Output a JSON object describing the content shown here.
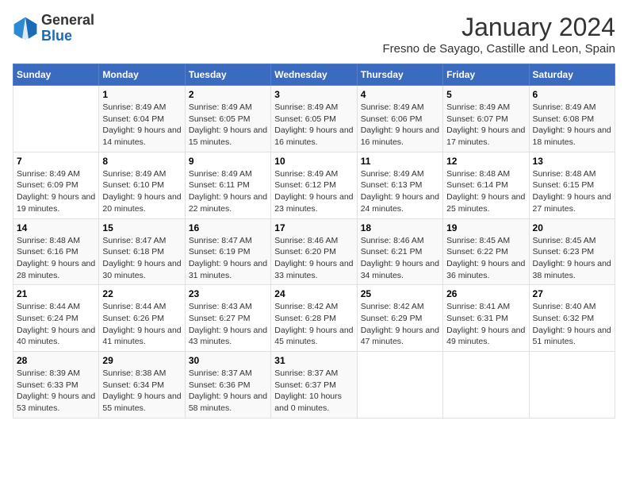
{
  "logo": {
    "general": "General",
    "blue": "Blue"
  },
  "title": "January 2024",
  "subtitle": "Fresno de Sayago, Castille and Leon, Spain",
  "weekdays": [
    "Sunday",
    "Monday",
    "Tuesday",
    "Wednesday",
    "Thursday",
    "Friday",
    "Saturday"
  ],
  "weeks": [
    [
      {
        "day": "",
        "sunrise": "",
        "sunset": "",
        "daylight": ""
      },
      {
        "day": "1",
        "sunrise": "Sunrise: 8:49 AM",
        "sunset": "Sunset: 6:04 PM",
        "daylight": "Daylight: 9 hours and 14 minutes."
      },
      {
        "day": "2",
        "sunrise": "Sunrise: 8:49 AM",
        "sunset": "Sunset: 6:05 PM",
        "daylight": "Daylight: 9 hours and 15 minutes."
      },
      {
        "day": "3",
        "sunrise": "Sunrise: 8:49 AM",
        "sunset": "Sunset: 6:05 PM",
        "daylight": "Daylight: 9 hours and 16 minutes."
      },
      {
        "day": "4",
        "sunrise": "Sunrise: 8:49 AM",
        "sunset": "Sunset: 6:06 PM",
        "daylight": "Daylight: 9 hours and 16 minutes."
      },
      {
        "day": "5",
        "sunrise": "Sunrise: 8:49 AM",
        "sunset": "Sunset: 6:07 PM",
        "daylight": "Daylight: 9 hours and 17 minutes."
      },
      {
        "day": "6",
        "sunrise": "Sunrise: 8:49 AM",
        "sunset": "Sunset: 6:08 PM",
        "daylight": "Daylight: 9 hours and 18 minutes."
      }
    ],
    [
      {
        "day": "7",
        "sunrise": "Sunrise: 8:49 AM",
        "sunset": "Sunset: 6:09 PM",
        "daylight": "Daylight: 9 hours and 19 minutes."
      },
      {
        "day": "8",
        "sunrise": "Sunrise: 8:49 AM",
        "sunset": "Sunset: 6:10 PM",
        "daylight": "Daylight: 9 hours and 20 minutes."
      },
      {
        "day": "9",
        "sunrise": "Sunrise: 8:49 AM",
        "sunset": "Sunset: 6:11 PM",
        "daylight": "Daylight: 9 hours and 22 minutes."
      },
      {
        "day": "10",
        "sunrise": "Sunrise: 8:49 AM",
        "sunset": "Sunset: 6:12 PM",
        "daylight": "Daylight: 9 hours and 23 minutes."
      },
      {
        "day": "11",
        "sunrise": "Sunrise: 8:49 AM",
        "sunset": "Sunset: 6:13 PM",
        "daylight": "Daylight: 9 hours and 24 minutes."
      },
      {
        "day": "12",
        "sunrise": "Sunrise: 8:48 AM",
        "sunset": "Sunset: 6:14 PM",
        "daylight": "Daylight: 9 hours and 25 minutes."
      },
      {
        "day": "13",
        "sunrise": "Sunrise: 8:48 AM",
        "sunset": "Sunset: 6:15 PM",
        "daylight": "Daylight: 9 hours and 27 minutes."
      }
    ],
    [
      {
        "day": "14",
        "sunrise": "Sunrise: 8:48 AM",
        "sunset": "Sunset: 6:16 PM",
        "daylight": "Daylight: 9 hours and 28 minutes."
      },
      {
        "day": "15",
        "sunrise": "Sunrise: 8:47 AM",
        "sunset": "Sunset: 6:18 PM",
        "daylight": "Daylight: 9 hours and 30 minutes."
      },
      {
        "day": "16",
        "sunrise": "Sunrise: 8:47 AM",
        "sunset": "Sunset: 6:19 PM",
        "daylight": "Daylight: 9 hours and 31 minutes."
      },
      {
        "day": "17",
        "sunrise": "Sunrise: 8:46 AM",
        "sunset": "Sunset: 6:20 PM",
        "daylight": "Daylight: 9 hours and 33 minutes."
      },
      {
        "day": "18",
        "sunrise": "Sunrise: 8:46 AM",
        "sunset": "Sunset: 6:21 PM",
        "daylight": "Daylight: 9 hours and 34 minutes."
      },
      {
        "day": "19",
        "sunrise": "Sunrise: 8:45 AM",
        "sunset": "Sunset: 6:22 PM",
        "daylight": "Daylight: 9 hours and 36 minutes."
      },
      {
        "day": "20",
        "sunrise": "Sunrise: 8:45 AM",
        "sunset": "Sunset: 6:23 PM",
        "daylight": "Daylight: 9 hours and 38 minutes."
      }
    ],
    [
      {
        "day": "21",
        "sunrise": "Sunrise: 8:44 AM",
        "sunset": "Sunset: 6:24 PM",
        "daylight": "Daylight: 9 hours and 40 minutes."
      },
      {
        "day": "22",
        "sunrise": "Sunrise: 8:44 AM",
        "sunset": "Sunset: 6:26 PM",
        "daylight": "Daylight: 9 hours and 41 minutes."
      },
      {
        "day": "23",
        "sunrise": "Sunrise: 8:43 AM",
        "sunset": "Sunset: 6:27 PM",
        "daylight": "Daylight: 9 hours and 43 minutes."
      },
      {
        "day": "24",
        "sunrise": "Sunrise: 8:42 AM",
        "sunset": "Sunset: 6:28 PM",
        "daylight": "Daylight: 9 hours and 45 minutes."
      },
      {
        "day": "25",
        "sunrise": "Sunrise: 8:42 AM",
        "sunset": "Sunset: 6:29 PM",
        "daylight": "Daylight: 9 hours and 47 minutes."
      },
      {
        "day": "26",
        "sunrise": "Sunrise: 8:41 AM",
        "sunset": "Sunset: 6:31 PM",
        "daylight": "Daylight: 9 hours and 49 minutes."
      },
      {
        "day": "27",
        "sunrise": "Sunrise: 8:40 AM",
        "sunset": "Sunset: 6:32 PM",
        "daylight": "Daylight: 9 hours and 51 minutes."
      }
    ],
    [
      {
        "day": "28",
        "sunrise": "Sunrise: 8:39 AM",
        "sunset": "Sunset: 6:33 PM",
        "daylight": "Daylight: 9 hours and 53 minutes."
      },
      {
        "day": "29",
        "sunrise": "Sunrise: 8:38 AM",
        "sunset": "Sunset: 6:34 PM",
        "daylight": "Daylight: 9 hours and 55 minutes."
      },
      {
        "day": "30",
        "sunrise": "Sunrise: 8:37 AM",
        "sunset": "Sunset: 6:36 PM",
        "daylight": "Daylight: 9 hours and 58 minutes."
      },
      {
        "day": "31",
        "sunrise": "Sunrise: 8:37 AM",
        "sunset": "Sunset: 6:37 PM",
        "daylight": "Daylight: 10 hours and 0 minutes."
      },
      {
        "day": "",
        "sunrise": "",
        "sunset": "",
        "daylight": ""
      },
      {
        "day": "",
        "sunrise": "",
        "sunset": "",
        "daylight": ""
      },
      {
        "day": "",
        "sunrise": "",
        "sunset": "",
        "daylight": ""
      }
    ]
  ]
}
